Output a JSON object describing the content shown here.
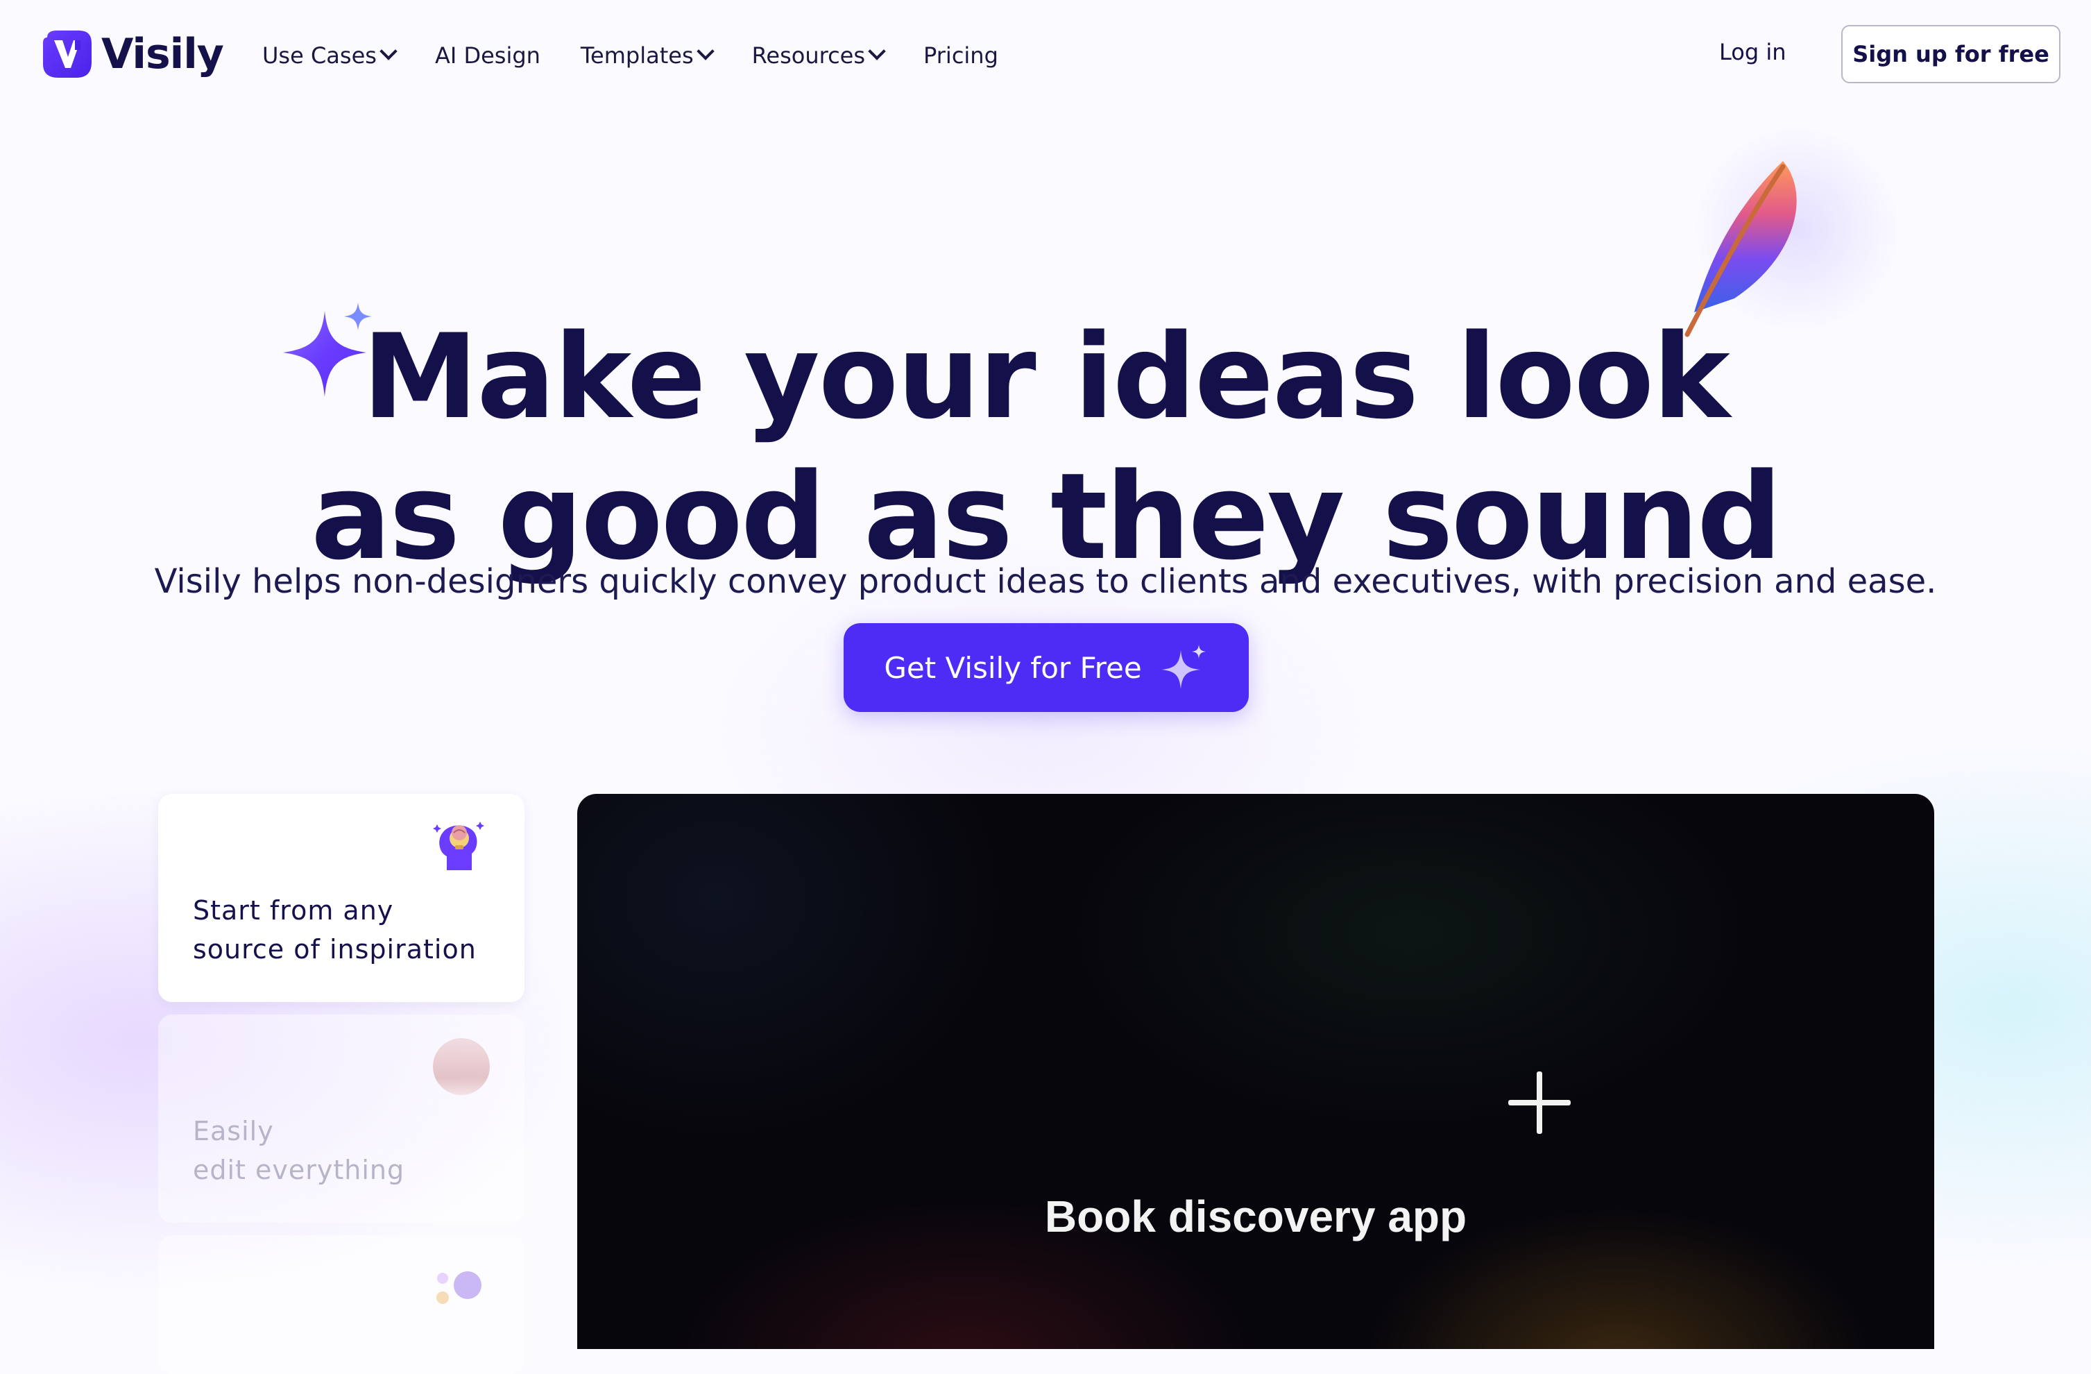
{
  "brand": {
    "name": "Visily",
    "accent": "#4f2cf5",
    "text_dark": "#14104a"
  },
  "nav": {
    "items": [
      {
        "label": "Use Cases",
        "has_dropdown": true
      },
      {
        "label": "AI Design",
        "has_dropdown": false
      },
      {
        "label": "Templates",
        "has_dropdown": true
      },
      {
        "label": "Resources",
        "has_dropdown": true
      },
      {
        "label": "Pricing",
        "has_dropdown": false
      }
    ],
    "login_label": "Log in",
    "signup_label": "Sign up for free"
  },
  "hero": {
    "line1": "Make your ideas look",
    "line2": "as good as they sound",
    "subtitle": "Visily helps non-designers quickly convey product ideas to clients and executives, with precision and ease.",
    "cta_label": "Get Visily for Free",
    "decorations": [
      "sparkle-icon",
      "feather-icon"
    ]
  },
  "features": [
    {
      "title_line1": "Start from any",
      "title_line2": "source of inspiration",
      "icon": "brain-lightbulb-icon",
      "active": true
    },
    {
      "title_line1": "Easily",
      "title_line2": "edit everything",
      "icon": "color-palette-icon",
      "active": false
    },
    {
      "title_line1": "",
      "title_line2": "",
      "icon": "dots-icon",
      "active": false
    }
  ],
  "video": {
    "caption": "Book discovery app",
    "overlay_icon": "plus-icon"
  }
}
